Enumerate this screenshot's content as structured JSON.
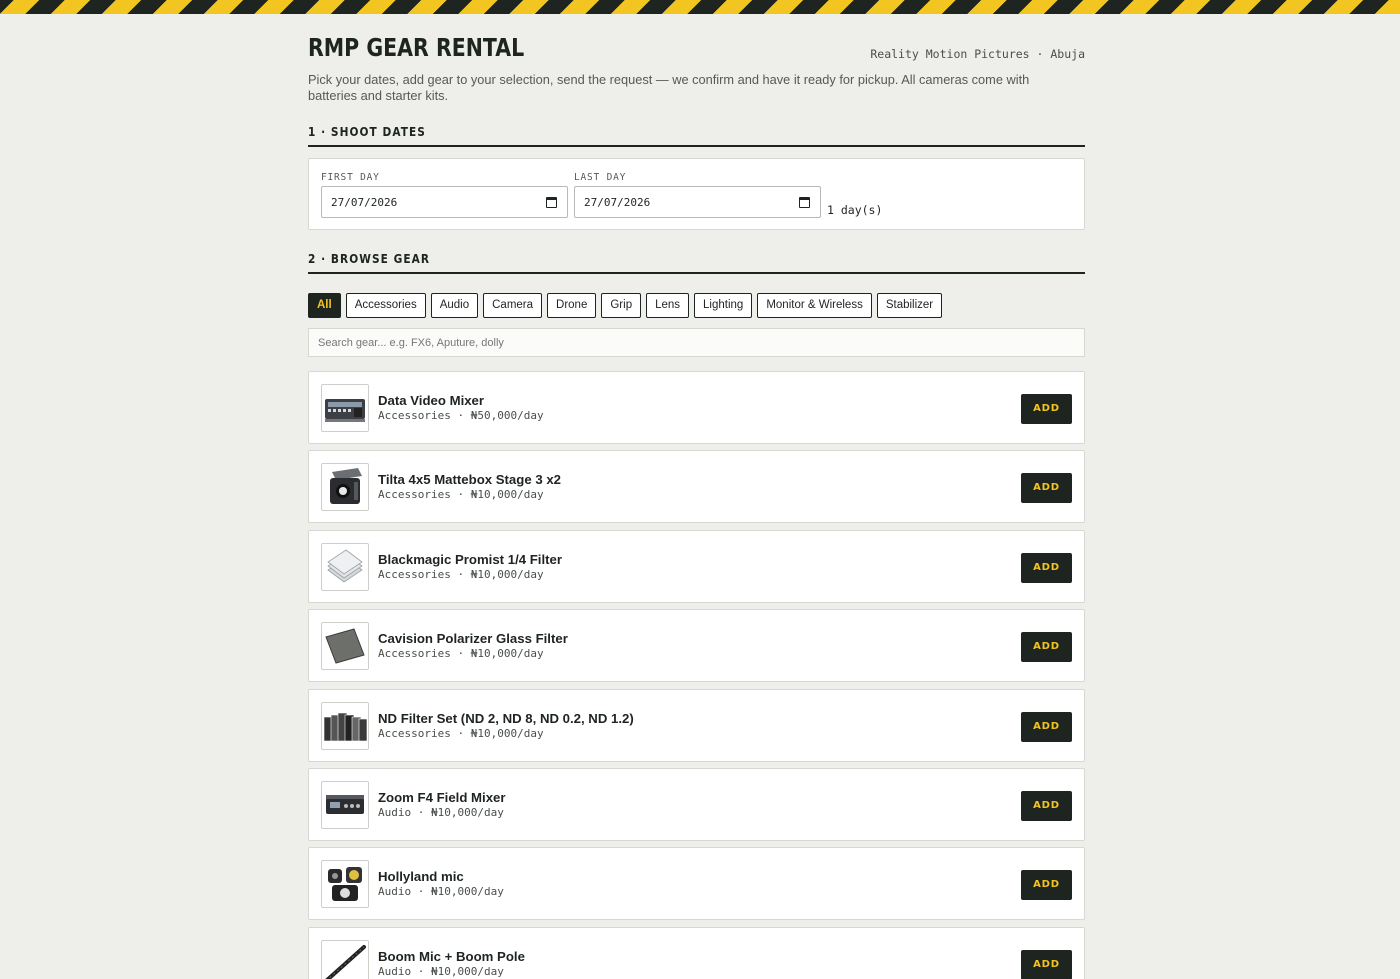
{
  "header": {
    "title": "RMP GEAR RENTAL",
    "company": "Reality Motion Pictures · Abuja",
    "intro": "Pick your dates, add gear to your selection, send the request — we confirm and have it ready for pickup. All cameras come with batteries and starter kits."
  },
  "dates": {
    "section_title": "1 · SHOOT DATES",
    "first_label": "FIRST DAY",
    "first_value": "27/07/2026",
    "last_label": "LAST DAY",
    "last_value": "27/07/2026",
    "duration": "1 day(s)"
  },
  "browse": {
    "section_title": "2 · BROWSE GEAR",
    "filters": [
      "All",
      "Accessories",
      "Audio",
      "Camera",
      "Drone",
      "Grip",
      "Lens",
      "Lighting",
      "Monitor & Wireless",
      "Stabilizer"
    ],
    "active_filter": "All",
    "search_placeholder": "Search gear... e.g. FX6, Aputure, dolly"
  },
  "items": [
    {
      "name": "Data Video Mixer",
      "meta": "Accessories · ₦50,000/day",
      "icon": "video-mixer-icon",
      "button": "ADD"
    },
    {
      "name": "Tilta 4x5 Mattebox Stage 3 x2",
      "meta": "Accessories · ₦10,000/day",
      "icon": "mattebox-icon",
      "button": "ADD"
    },
    {
      "name": "Blackmagic Promist 1/4 Filter",
      "meta": "Accessories · ₦10,000/day",
      "icon": "filter-stack-icon",
      "button": "ADD"
    },
    {
      "name": "Cavision Polarizer Glass Filter",
      "meta": "Accessories · ₦10,000/day",
      "icon": "glass-filter-icon",
      "button": "ADD"
    },
    {
      "name": "ND Filter Set (ND 2, ND 8, ND 0.2, ND 1.2)",
      "meta": "Accessories · ₦10,000/day",
      "icon": "nd-filter-set-icon",
      "button": "ADD"
    },
    {
      "name": "Zoom F4 Field Mixer",
      "meta": "Audio · ₦10,000/day",
      "icon": "field-mixer-icon",
      "button": "ADD"
    },
    {
      "name": "Hollyland mic",
      "meta": "Audio · ₦10,000/day",
      "icon": "wireless-mic-icon",
      "button": "ADD"
    },
    {
      "name": "Boom Mic + Boom Pole",
      "meta": "Audio · ₦10,000/day",
      "icon": "boom-pole-icon",
      "button": "ADD"
    }
  ],
  "colors": {
    "accent": "#f2c520",
    "dark": "#1e2420",
    "background": "#eeeeea"
  }
}
